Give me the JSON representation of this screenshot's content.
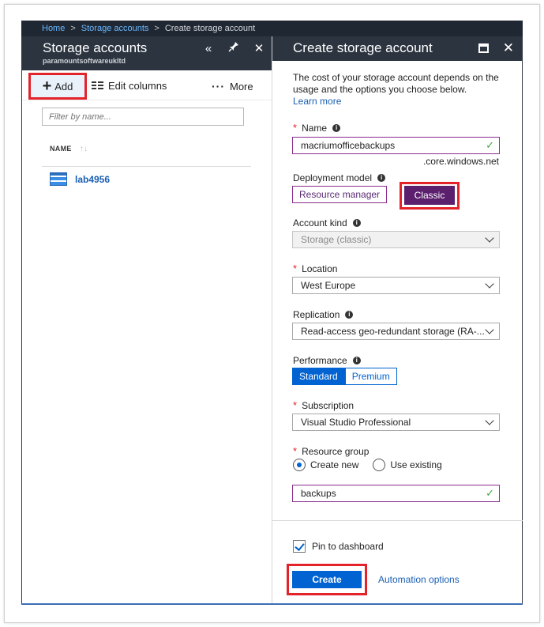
{
  "breadcrumb": {
    "home": "Home",
    "storage": "Storage accounts",
    "current": "Create storage account",
    "sep": ">"
  },
  "left_blade": {
    "title": "Storage accounts",
    "subtitle": "paramountsoftwareukltd",
    "icons": {
      "collapse": "«",
      "pin": "📌",
      "close": "✕"
    },
    "toolbar": {
      "add_label": "Add",
      "edit_columns_label": "Edit columns",
      "more_label": "More"
    },
    "filter_placeholder": "Filter by name...",
    "column_name": "NAME",
    "rows": [
      {
        "name": "lab4956"
      }
    ]
  },
  "right_blade": {
    "title": "Create storage account",
    "description": "The cost of your storage account depends on the usage and the options you choose below.",
    "learn_more": "Learn more",
    "name": {
      "label": "Name",
      "value": "macriumofficebackups",
      "suffix": ".core.windows.net"
    },
    "deployment_model": {
      "label": "Deployment model",
      "options": [
        "Resource manager",
        "Classic"
      ],
      "selected": "Classic"
    },
    "account_kind": {
      "label": "Account kind",
      "value": "Storage (classic)"
    },
    "location": {
      "label": "Location",
      "value": "West Europe"
    },
    "replication": {
      "label": "Replication",
      "value": "Read-access geo-redundant storage (RA-..."
    },
    "performance": {
      "label": "Performance",
      "options": [
        "Standard",
        "Premium"
      ],
      "selected": "Standard"
    },
    "subscription": {
      "label": "Subscription",
      "value": "Visual Studio Professional"
    },
    "resource_group": {
      "label": "Resource group",
      "create_new": "Create new",
      "use_existing": "Use existing",
      "value": "backups"
    },
    "pin_label": "Pin to dashboard",
    "create_label": "Create",
    "automation_label": "Automation options"
  },
  "colors": {
    "accent": "#0063d1",
    "purple": "#5c1f6e",
    "highlight": "#e3222a",
    "header": "#2c3440"
  }
}
